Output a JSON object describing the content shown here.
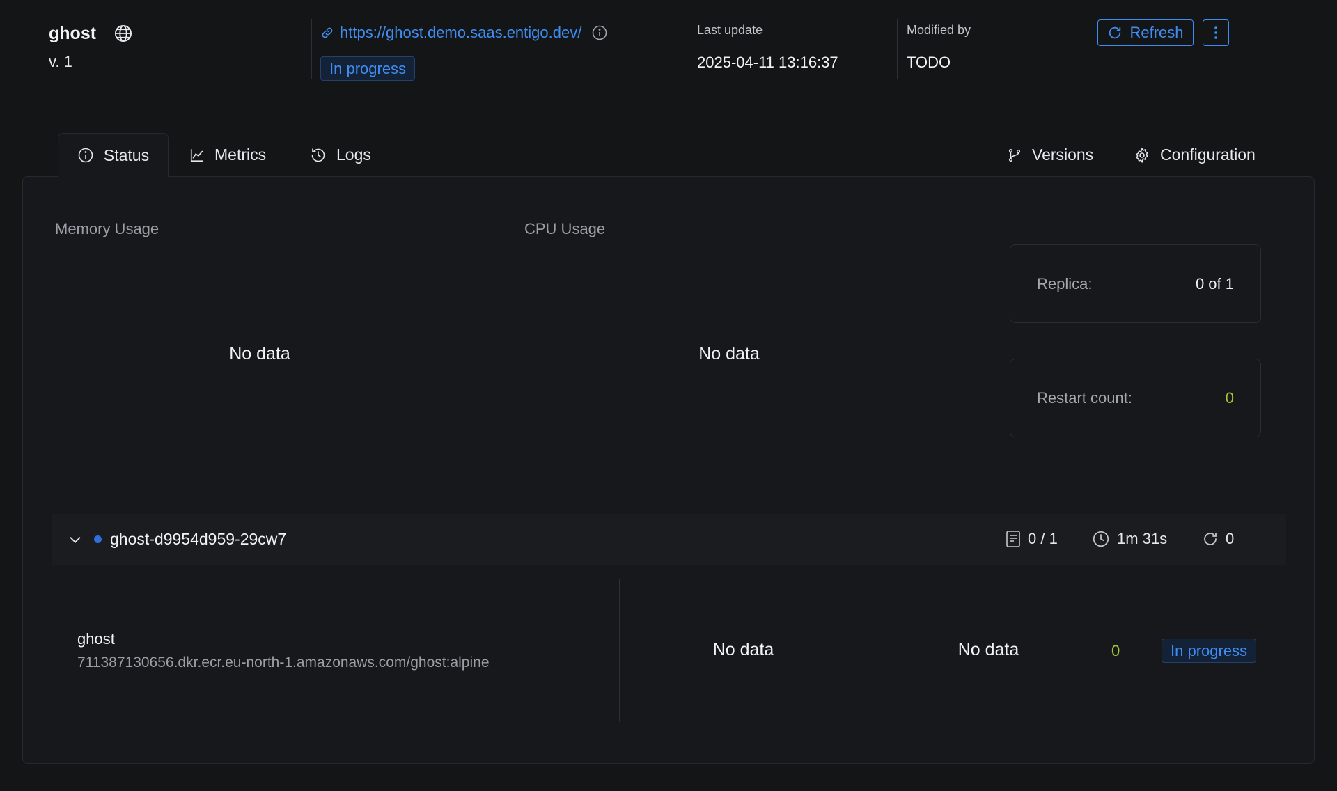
{
  "header": {
    "app_name": "ghost",
    "version": "v. 1",
    "url": "https://ghost.demo.saas.entigo.dev/",
    "status": "In progress",
    "last_update_label": "Last update",
    "last_update_value": "2025-04-11 13:16:37",
    "modified_by_label": "Modified by",
    "modified_by_value": "TODO",
    "refresh_label": "Refresh"
  },
  "tabs": [
    {
      "label": "Status",
      "icon": "info-icon",
      "active": true
    },
    {
      "label": "Metrics",
      "icon": "chart-line-icon"
    },
    {
      "label": "Logs",
      "icon": "history-icon"
    },
    {
      "label": "Versions",
      "icon": "branch-icon"
    },
    {
      "label": "Configuration",
      "icon": "gear-icon"
    }
  ],
  "charts": {
    "memory_title": "Memory Usage",
    "memory_empty": "No data",
    "cpu_title": "CPU Usage",
    "cpu_empty": "No data"
  },
  "stats": {
    "replica_label": "Replica:",
    "replica_value": "0 of 1",
    "restart_label": "Restart count:",
    "restart_value": "0"
  },
  "pod": {
    "name": "ghost-d9954d959-29cw7",
    "containers": "0 / 1",
    "age": "1m 31s",
    "restarts": "0",
    "status_color": "#2f6fdc",
    "container": {
      "name": "ghost",
      "image": "711387130656.dkr.ecr.eu-north-1.amazonaws.com/ghost:alpine",
      "memory": "No data",
      "cpu": "No data",
      "restarts": "0",
      "status": "In progress"
    }
  }
}
